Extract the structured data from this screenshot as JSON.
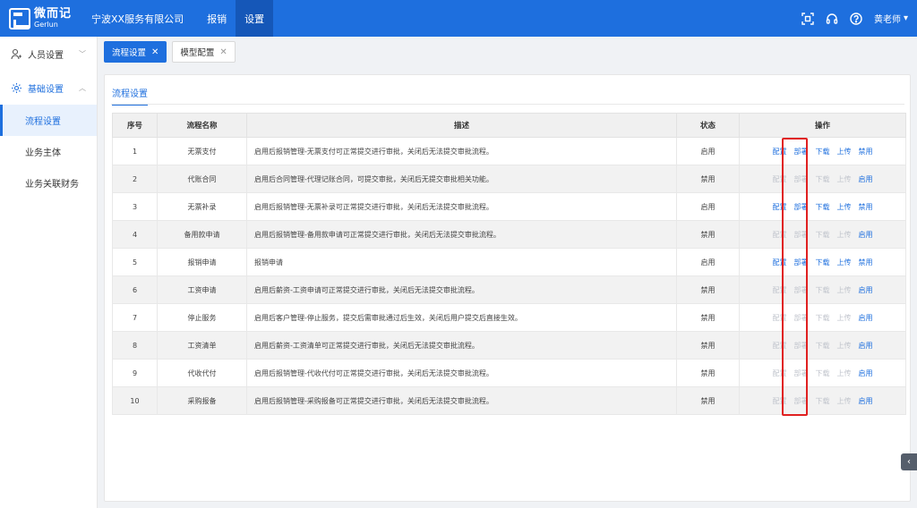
{
  "header": {
    "logo_cn": "微而记",
    "logo_en": "Gerlun",
    "company": "宁波XX服务有限公司",
    "nav": [
      {
        "label": "报销",
        "active": false
      },
      {
        "label": "设置",
        "active": true
      }
    ],
    "icons": [
      "scan-icon",
      "headset-icon",
      "help-icon"
    ],
    "user": "黄老师"
  },
  "sidebar": {
    "groups": [
      {
        "label": "人员设置",
        "icon": "user-icon",
        "open": false,
        "items": []
      },
      {
        "label": "基础设置",
        "icon": "gear-icon",
        "open": true,
        "items": [
          {
            "label": "流程设置",
            "active": true
          },
          {
            "label": "业务主体",
            "active": false
          },
          {
            "label": "业务关联财务",
            "active": false
          }
        ]
      }
    ]
  },
  "tabs": [
    {
      "label": "流程设置",
      "active": true
    },
    {
      "label": "模型配置",
      "active": false
    }
  ],
  "subtab": "流程设置",
  "table": {
    "headers": [
      "序号",
      "流程名称",
      "描述",
      "状态",
      "操作"
    ],
    "op_labels": [
      "配置",
      "部署",
      "下载",
      "上传"
    ],
    "rows": [
      {
        "no": "1",
        "name": "无票支付",
        "desc": "启用后报销管理-无票支付可正常提交进行审批，关闭后无法提交审批流程。",
        "status": "启用",
        "toggle": "禁用",
        "enabled": true
      },
      {
        "no": "2",
        "name": "代账合同",
        "desc": "启用后合同管理-代理记账合同，可提交审批，关闭后无提交审批相关功能。",
        "status": "禁用",
        "toggle": "启用",
        "enabled": false
      },
      {
        "no": "3",
        "name": "无票补录",
        "desc": "启用后报销管理-无票补录可正常提交进行审批，关闭后无法提交审批流程。",
        "status": "启用",
        "toggle": "禁用",
        "enabled": true
      },
      {
        "no": "4",
        "name": "备用款申请",
        "desc": "启用后报销管理-备用款申请可正常提交进行审批，关闭后无法提交审批流程。",
        "status": "禁用",
        "toggle": "启用",
        "enabled": false
      },
      {
        "no": "5",
        "name": "报销申请",
        "desc": "报销申请",
        "status": "启用",
        "toggle": "禁用",
        "enabled": true
      },
      {
        "no": "6",
        "name": "工资申请",
        "desc": "启用后薪资-工资申请可正常提交进行审批，关闭后无法提交审批流程。",
        "status": "禁用",
        "toggle": "启用",
        "enabled": false
      },
      {
        "no": "7",
        "name": "停止服务",
        "desc": "启用后客户管理-停止服务，提交后需审批通过后生效，关闭后用户提交后直接生效。",
        "status": "禁用",
        "toggle": "启用",
        "enabled": false
      },
      {
        "no": "8",
        "name": "工资清单",
        "desc": "启用后薪资-工资清单可正常提交进行审批，关闭后无法提交审批流程。",
        "status": "禁用",
        "toggle": "启用",
        "enabled": false
      },
      {
        "no": "9",
        "name": "代收代付",
        "desc": "启用后报销管理-代收代付可正常提交进行审批，关闭后无法提交审批流程。",
        "status": "禁用",
        "toggle": "启用",
        "enabled": false
      },
      {
        "no": "10",
        "name": "采购报备",
        "desc": "启用后报销管理-采购报备可正常提交进行审批，关闭后无法提交审批流程。",
        "status": "禁用",
        "toggle": "启用",
        "enabled": false
      }
    ]
  },
  "colors": {
    "primary": "#1e6fde",
    "disabled": "#c0c4cc",
    "highlight": "#e02020"
  }
}
